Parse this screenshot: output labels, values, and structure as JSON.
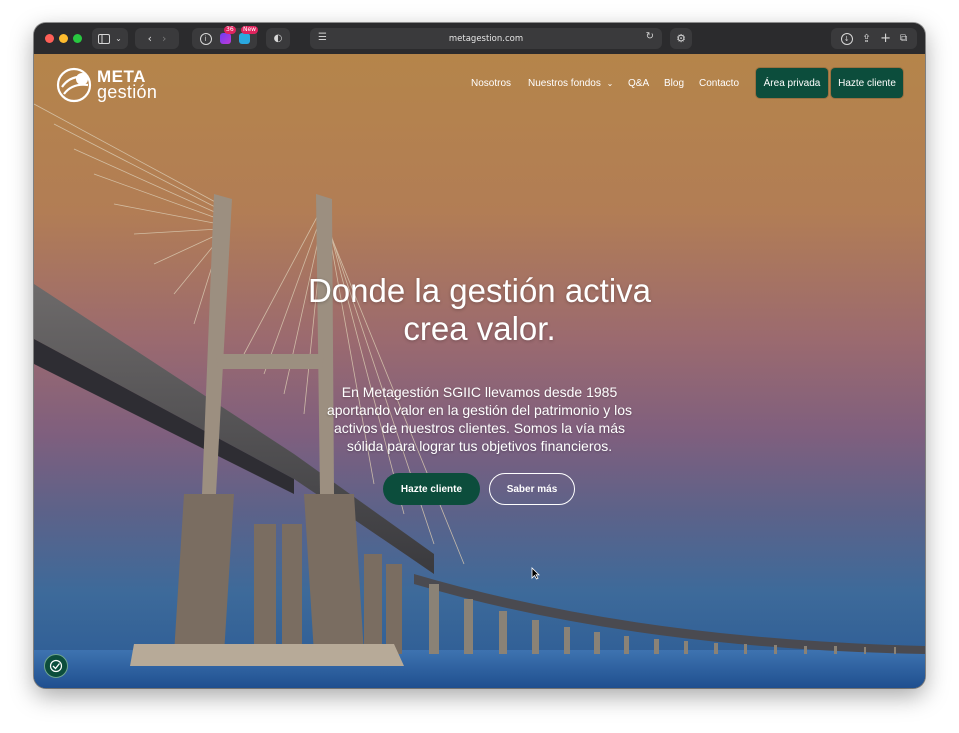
{
  "browser": {
    "url": "metagestion.com",
    "badge_extension_1": "36",
    "badge_extension_2": "New"
  },
  "logo": {
    "top": "META",
    "bottom": "gestión"
  },
  "nav": {
    "links": [
      "Nosotros",
      "Nuestros fondos",
      "Q&A",
      "Blog",
      "Contacto"
    ],
    "area_privada": "Área privada",
    "hazte_cliente": "Hazte cliente"
  },
  "hero": {
    "title_line1": "Donde la gestión activa",
    "title_line2": "crea valor.",
    "text": "En Metagestión SGIIC llevamos desde 1985 aportando valor en la gestión del patrimonio y los activos de nuestros clientes. Somos la vía más sólida para lograr tus objetivos financieros.",
    "cta_primary": "Hazte cliente",
    "cta_secondary": "Saber más"
  },
  "colors": {
    "brand_green": "#0c4d3c",
    "text": "#ffffff"
  },
  "icons": [
    "sidebar-icon",
    "chevron-down-icon",
    "back-icon",
    "forward-icon",
    "info-icon",
    "shield-icon",
    "reader-icon",
    "reload-icon",
    "settings-icon",
    "download-icon",
    "share-icon",
    "new-tab-icon",
    "tabs-overview-icon",
    "accessibility-icon"
  ]
}
